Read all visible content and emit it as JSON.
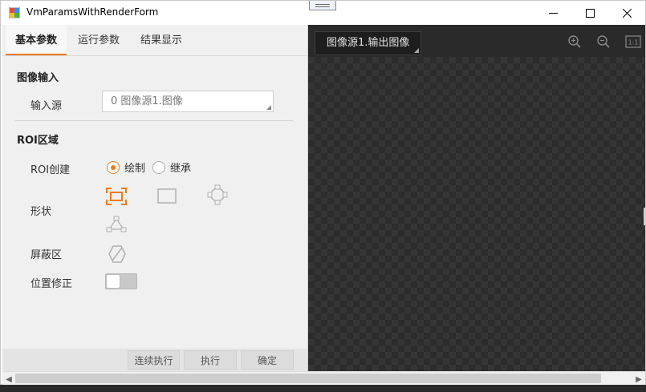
{
  "window": {
    "title": "VmParamsWithRenderForm",
    "controls": [
      "minimize-icon",
      "maximize-icon",
      "close-icon"
    ]
  },
  "tabs": [
    {
      "label": "基本参数",
      "active": true
    },
    {
      "label": "运行参数",
      "active": false
    },
    {
      "label": "结果显示",
      "active": false
    }
  ],
  "image_input": {
    "section_title": "图像输入",
    "source_label": "输入源",
    "source_value": "0 图像源1.图像"
  },
  "roi": {
    "section_title": "ROI区域",
    "create_label": "ROI创建",
    "options": [
      {
        "label": "绘制",
        "selected": true
      },
      {
        "label": "继承",
        "selected": false
      }
    ],
    "shape_label": "形状",
    "shapes": [
      "box-shape-icon",
      "rectangle-shape-icon",
      "annulus-shape-icon",
      "polygon-shape-icon"
    ],
    "mask_label": "屏蔽区",
    "mask_icon": "mask-icon",
    "position_fix_label": "位置修正",
    "position_fix_on": false
  },
  "footer": {
    "continuous_run": "连续执行",
    "run": "执行",
    "confirm": "确定"
  },
  "viewer": {
    "source_tag": "图像源1.输出图像",
    "tools": [
      "zoom-in-icon",
      "zoom-out-icon",
      "actual-size-icon"
    ],
    "actual_size_text": "1:1"
  },
  "colors": {
    "accent": "#f07a1a",
    "viewer_bg": "#2f2f2f"
  }
}
